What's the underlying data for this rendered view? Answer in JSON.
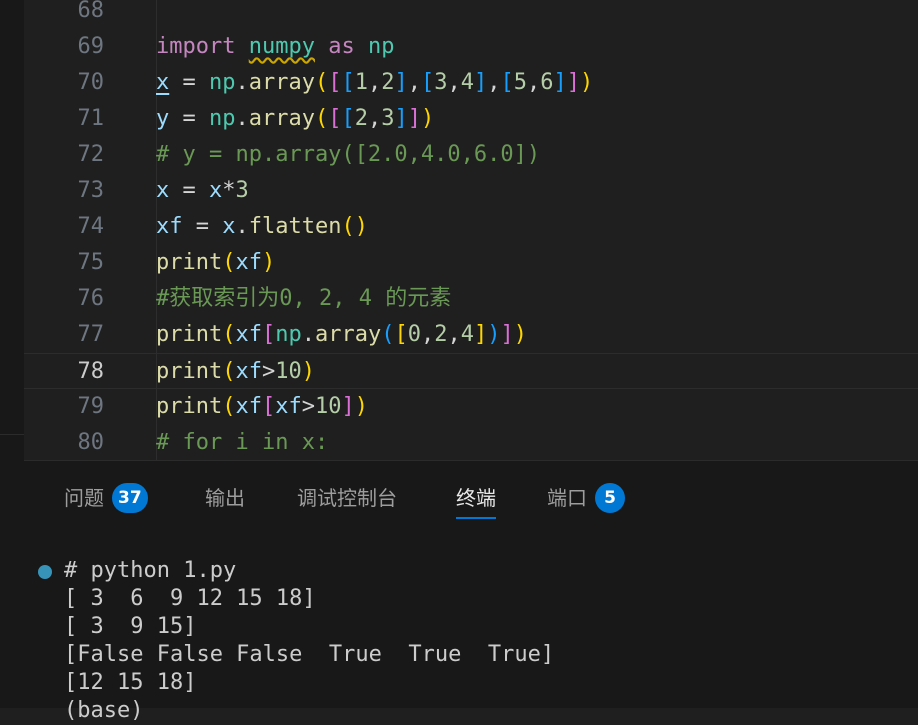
{
  "editor": {
    "lines": [
      {
        "n": "68",
        "tokens": []
      },
      {
        "n": "69",
        "tokens": [
          [
            "kw",
            "import"
          ],
          [
            "op",
            " "
          ],
          [
            "mod squig",
            "numpy"
          ],
          [
            "op",
            " "
          ],
          [
            "kw",
            "as"
          ],
          [
            "op",
            " "
          ],
          [
            "mod",
            "np"
          ]
        ]
      },
      {
        "n": "70",
        "tokens": [
          [
            "var uline",
            "x"
          ],
          [
            "op",
            " = "
          ],
          [
            "mod",
            "np"
          ],
          [
            "op",
            "."
          ],
          [
            "fn",
            "array"
          ],
          [
            "b1",
            "("
          ],
          [
            "b2",
            "["
          ],
          [
            "b3",
            "["
          ],
          [
            "num",
            "1"
          ],
          [
            "op",
            ","
          ],
          [
            "num",
            "2"
          ],
          [
            "b3",
            "]"
          ],
          [
            "op",
            ","
          ],
          [
            "b3",
            "["
          ],
          [
            "num",
            "3"
          ],
          [
            "op",
            ","
          ],
          [
            "num",
            "4"
          ],
          [
            "b3",
            "]"
          ],
          [
            "op",
            ","
          ],
          [
            "b3",
            "["
          ],
          [
            "num",
            "5"
          ],
          [
            "op",
            ","
          ],
          [
            "num",
            "6"
          ],
          [
            "b3",
            "]"
          ],
          [
            "b2",
            "]"
          ],
          [
            "b1",
            ")"
          ]
        ]
      },
      {
        "n": "71",
        "tokens": [
          [
            "var",
            "y"
          ],
          [
            "op",
            " = "
          ],
          [
            "mod",
            "np"
          ],
          [
            "op",
            "."
          ],
          [
            "fn",
            "array"
          ],
          [
            "b1",
            "("
          ],
          [
            "b2",
            "["
          ],
          [
            "b3",
            "["
          ],
          [
            "num",
            "2"
          ],
          [
            "op",
            ","
          ],
          [
            "num",
            "3"
          ],
          [
            "b3",
            "]"
          ],
          [
            "b2",
            "]"
          ],
          [
            "b1",
            ")"
          ]
        ]
      },
      {
        "n": "72",
        "tokens": [
          [
            "cm",
            "# y = np.array([2.0,4.0,6.0])"
          ]
        ]
      },
      {
        "n": "73",
        "tokens": [
          [
            "var",
            "x"
          ],
          [
            "op",
            " = "
          ],
          [
            "var",
            "x"
          ],
          [
            "op",
            "*"
          ],
          [
            "num",
            "3"
          ]
        ]
      },
      {
        "n": "74",
        "tokens": [
          [
            "var",
            "xf"
          ],
          [
            "op",
            " = "
          ],
          [
            "var",
            "x"
          ],
          [
            "op",
            "."
          ],
          [
            "fn",
            "flatten"
          ],
          [
            "b1",
            "()"
          ]
        ]
      },
      {
        "n": "75",
        "tokens": [
          [
            "fn",
            "print"
          ],
          [
            "b1",
            "("
          ],
          [
            "var",
            "xf"
          ],
          [
            "b1",
            ")"
          ]
        ]
      },
      {
        "n": "76",
        "tokens": [
          [
            "cm",
            "#获取索引为0, 2, 4 的元素"
          ]
        ]
      },
      {
        "n": "77",
        "tokens": [
          [
            "fn",
            "print"
          ],
          [
            "b1",
            "("
          ],
          [
            "var",
            "xf"
          ],
          [
            "b2",
            "["
          ],
          [
            "mod",
            "np"
          ],
          [
            "op",
            "."
          ],
          [
            "fn",
            "array"
          ],
          [
            "b3",
            "("
          ],
          [
            "b1",
            "["
          ],
          [
            "num",
            "0"
          ],
          [
            "op",
            ","
          ],
          [
            "num",
            "2"
          ],
          [
            "op",
            ","
          ],
          [
            "num",
            "4"
          ],
          [
            "b1",
            "]"
          ],
          [
            "b3",
            ")"
          ],
          [
            "b2",
            "]"
          ],
          [
            "b1",
            ")"
          ]
        ]
      },
      {
        "n": "78",
        "tokens": [
          [
            "fn",
            "print"
          ],
          [
            "b1",
            "("
          ],
          [
            "var",
            "xf"
          ],
          [
            "op",
            ">"
          ],
          [
            "num",
            "10"
          ],
          [
            "b1",
            ")"
          ]
        ],
        "current": true
      },
      {
        "n": "79",
        "tokens": [
          [
            "fn",
            "print"
          ],
          [
            "b1",
            "("
          ],
          [
            "var",
            "xf"
          ],
          [
            "b2",
            "["
          ],
          [
            "var",
            "xf"
          ],
          [
            "op",
            ">"
          ],
          [
            "num",
            "10"
          ],
          [
            "b2",
            "]"
          ],
          [
            "b1",
            ")"
          ]
        ]
      },
      {
        "n": "80",
        "tokens": [
          [
            "cm",
            "# for i in x:"
          ]
        ]
      }
    ]
  },
  "panel": {
    "tabs": [
      {
        "label": "问题",
        "badge": "37",
        "active": false
      },
      {
        "label": "输出",
        "badge": null,
        "active": false
      },
      {
        "label": "调试控制台",
        "badge": null,
        "active": false
      },
      {
        "label": "终端",
        "badge": null,
        "active": true
      },
      {
        "label": "端口",
        "badge": "5",
        "active": false
      }
    ],
    "terminal": {
      "lines": [
        "# python 1.py",
        "[ 3  6  9 12 15 18]",
        "[ 3  9 15]",
        "[False False False  True  True  True]",
        "[12 15 18]",
        "(base)"
      ]
    }
  },
  "colors": {
    "accent": "#0078d4",
    "background": "#1f1f1f",
    "panel": "#181818"
  }
}
